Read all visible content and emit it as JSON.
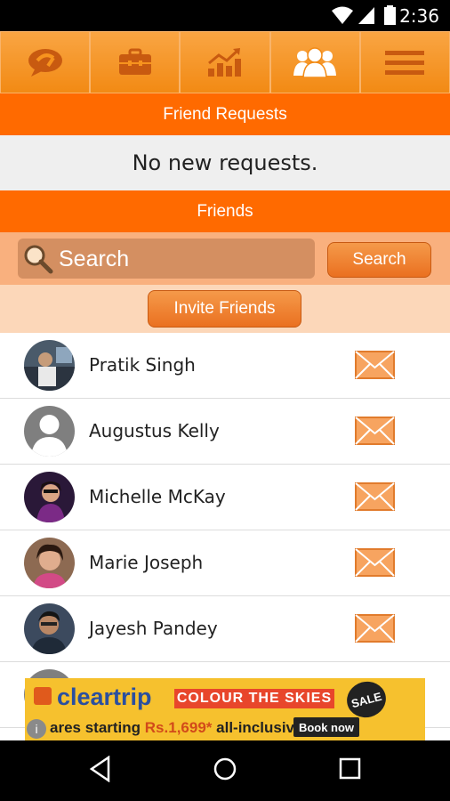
{
  "status_bar": {
    "time": "2:36"
  },
  "top_nav": {
    "tabs": [
      "chat-icon",
      "briefcase-icon",
      "chart-icon",
      "friends-icon",
      "menu-icon"
    ]
  },
  "friend_requests": {
    "header": "Friend Requests",
    "empty_text": "No new requests."
  },
  "friends": {
    "header": "Friends",
    "search": {
      "placeholder": "Search",
      "button_label": "Search"
    },
    "invite_label": "Invite Friends",
    "list": [
      {
        "name": "Pratik Singh"
      },
      {
        "name": "Augustus Kelly"
      },
      {
        "name": "Michelle McKay"
      },
      {
        "name": "Marie Joseph"
      },
      {
        "name": "Jayesh Pandey"
      }
    ]
  },
  "ad": {
    "brand": "cleartrip",
    "slogan": "COLOUR THE SKIES",
    "badge": "SALE",
    "offer_prefix": "ares starting",
    "offer_price": "Rs.1,699*",
    "offer_suffix": "all-inclusive",
    "cta": "Book now"
  },
  "colors": {
    "accent": "#ff6a00",
    "nav": "#f7931e"
  }
}
